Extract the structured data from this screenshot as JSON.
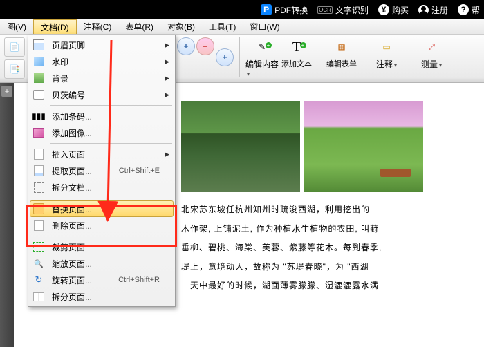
{
  "topbar": {
    "pdf_convert": "PDF转换",
    "ocr": "文字识别",
    "buy": "购买",
    "register": "注册",
    "help": "帮"
  },
  "menubar": {
    "view": "图(V)",
    "document": "文档(D)",
    "comment": "注释(C)",
    "form": "表单(R)",
    "object": "对象(B)",
    "tools": "工具(T)",
    "window": "窗口(W)"
  },
  "toolbar": {
    "zoom_out": "−",
    "zoom_in": "+",
    "edit_content": "编辑内容",
    "add_text": "添加文本",
    "edit_form": "编辑表单",
    "annotate": "注释",
    "measure": "测量"
  },
  "dropdown": {
    "items": [
      {
        "label": "页眉页脚",
        "sub": true,
        "icon": "hf"
      },
      {
        "label": "水印",
        "sub": true,
        "icon": "wm"
      },
      {
        "label": "背景",
        "sub": true,
        "icon": "bg"
      },
      {
        "label": "贝茨编号",
        "sub": true,
        "icon": "bt"
      },
      {
        "label": "添加条码...",
        "icon": "bc"
      },
      {
        "label": "添加图像...",
        "icon": "im"
      },
      {
        "label": "插入页面",
        "sub": true,
        "icon": "pg"
      },
      {
        "label": "提取页面...",
        "shortcut": "Ctrl+Shift+E",
        "icon": "eq"
      },
      {
        "label": "拆分文档...",
        "icon": "sp"
      },
      {
        "label": "替换页面...",
        "icon": "rp",
        "highlight": true
      },
      {
        "label": "删除页面...",
        "icon": "dp"
      },
      {
        "label": "裁剪页面",
        "icon": "cp"
      },
      {
        "label": "缩放页面...",
        "icon": "zp"
      },
      {
        "label": "旋转页面...",
        "shortcut": "Ctrl+Shift+R",
        "icon": "rt"
      },
      {
        "label": "拆分页面...",
        "icon": "s2"
      }
    ]
  },
  "doc": {
    "p1": "北宋苏东坡任杭州知州时疏浚西湖，利用挖出的",
    "p2": "木作架, 上铺泥土, 作为种植水生植物的农田, 叫葑",
    "p3": "垂柳、碧桃、海棠、芙蓉、紫藤等花木。每到春季,",
    "p4": "堤上，意境动人，故称为 \"苏堤春晓\"，为 \"西湖",
    "p5": "一天中最好的时候，湖面薄雾朦朦、湿漉漉露水满"
  }
}
